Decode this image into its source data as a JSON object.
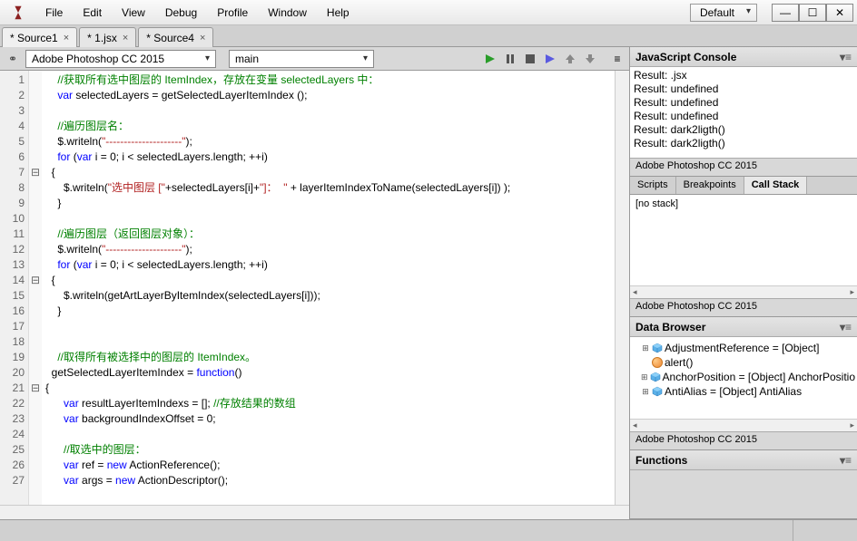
{
  "menu": [
    "File",
    "Edit",
    "View",
    "Debug",
    "Profile",
    "Window",
    "Help"
  ],
  "titleDropdown": "Default",
  "tabs": [
    {
      "label": "* Source1",
      "active": true
    },
    {
      "label": "* 1.jsx",
      "active": false
    },
    {
      "label": "* Source4",
      "active": false
    }
  ],
  "targetApp": "Adobe Photoshop CC 2015",
  "targetFunc": "main",
  "code": {
    "lines": [
      {
        "n": 1,
        "fold": "",
        "segs": [
          {
            "t": "    ",
            "c": ""
          },
          {
            "t": "//获取所有选中图层的 ItemIndex，存放在变量 selectedLayers 中：",
            "c": "c-com"
          }
        ]
      },
      {
        "n": 2,
        "fold": "",
        "segs": [
          {
            "t": "    ",
            "c": ""
          },
          {
            "t": "var",
            "c": "c-kw"
          },
          {
            "t": " selectedLayers = getSelectedLayerItemIndex ();",
            "c": ""
          }
        ]
      },
      {
        "n": 3,
        "fold": "",
        "segs": [
          {
            "t": "",
            "c": ""
          }
        ]
      },
      {
        "n": 4,
        "fold": "",
        "segs": [
          {
            "t": "    ",
            "c": ""
          },
          {
            "t": "//遍历图层名：",
            "c": "c-com"
          }
        ]
      },
      {
        "n": 5,
        "fold": "",
        "segs": [
          {
            "t": "    $.writeln(",
            "c": ""
          },
          {
            "t": "\"---------------------\"",
            "c": "c-str"
          },
          {
            "t": ");",
            "c": ""
          }
        ]
      },
      {
        "n": 6,
        "fold": "",
        "segs": [
          {
            "t": "    ",
            "c": ""
          },
          {
            "t": "for",
            "c": "c-kw"
          },
          {
            "t": " (",
            "c": ""
          },
          {
            "t": "var",
            "c": "c-kw"
          },
          {
            "t": " i = ",
            "c": ""
          },
          {
            "t": "0",
            "c": "c-num"
          },
          {
            "t": "; i < selectedLayers.length; ++i)",
            "c": ""
          }
        ]
      },
      {
        "n": 7,
        "fold": "⊟",
        "segs": [
          {
            "t": "  {",
            "c": ""
          }
        ]
      },
      {
        "n": 8,
        "fold": "",
        "segs": [
          {
            "t": "      $.writeln(",
            "c": ""
          },
          {
            "t": "\"选中图层 [\"",
            "c": "c-str"
          },
          {
            "t": "+selectedLayers[i]+",
            "c": ""
          },
          {
            "t": "\"]：  \"",
            "c": "c-str"
          },
          {
            "t": " + layerItemIndexToName(selectedLayers[i]) );",
            "c": ""
          }
        ]
      },
      {
        "n": 9,
        "fold": "",
        "segs": [
          {
            "t": "    }",
            "c": ""
          }
        ]
      },
      {
        "n": 10,
        "fold": "",
        "segs": [
          {
            "t": "",
            "c": ""
          }
        ]
      },
      {
        "n": 11,
        "fold": "",
        "segs": [
          {
            "t": "    ",
            "c": ""
          },
          {
            "t": "//遍历图层（返回图层对象）：",
            "c": "c-com"
          }
        ]
      },
      {
        "n": 12,
        "fold": "",
        "segs": [
          {
            "t": "    $.writeln(",
            "c": ""
          },
          {
            "t": "\"---------------------\"",
            "c": "c-str"
          },
          {
            "t": ");",
            "c": ""
          }
        ]
      },
      {
        "n": 13,
        "fold": "",
        "segs": [
          {
            "t": "    ",
            "c": ""
          },
          {
            "t": "for",
            "c": "c-kw"
          },
          {
            "t": " (",
            "c": ""
          },
          {
            "t": "var",
            "c": "c-kw"
          },
          {
            "t": " i = ",
            "c": ""
          },
          {
            "t": "0",
            "c": "c-num"
          },
          {
            "t": "; i < selectedLayers.length; ++i)",
            "c": ""
          }
        ]
      },
      {
        "n": 14,
        "fold": "⊟",
        "segs": [
          {
            "t": "  {",
            "c": ""
          }
        ]
      },
      {
        "n": 15,
        "fold": "",
        "segs": [
          {
            "t": "      $.writeln(getArtLayerByItemIndex(selectedLayers[i]));",
            "c": ""
          }
        ]
      },
      {
        "n": 16,
        "fold": "",
        "segs": [
          {
            "t": "    }",
            "c": ""
          }
        ]
      },
      {
        "n": 17,
        "fold": "",
        "segs": [
          {
            "t": "",
            "c": ""
          }
        ]
      },
      {
        "n": 18,
        "fold": "",
        "segs": [
          {
            "t": "",
            "c": ""
          }
        ]
      },
      {
        "n": 19,
        "fold": "",
        "segs": [
          {
            "t": "    ",
            "c": ""
          },
          {
            "t": "//取得所有被选择中的图层的 ItemIndex。",
            "c": "c-com"
          }
        ]
      },
      {
        "n": 20,
        "fold": "",
        "segs": [
          {
            "t": "  getSelectedLayerItemIndex = ",
            "c": ""
          },
          {
            "t": "function",
            "c": "c-kw"
          },
          {
            "t": "()",
            "c": ""
          }
        ]
      },
      {
        "n": 21,
        "fold": "⊟",
        "segs": [
          {
            "t": "{",
            "c": ""
          }
        ]
      },
      {
        "n": 22,
        "fold": "",
        "segs": [
          {
            "t": "      ",
            "c": ""
          },
          {
            "t": "var",
            "c": "c-kw"
          },
          {
            "t": " resultLayerItemIndexs = []; ",
            "c": ""
          },
          {
            "t": "//存放结果的数组",
            "c": "c-com"
          }
        ]
      },
      {
        "n": 23,
        "fold": "",
        "segs": [
          {
            "t": "      ",
            "c": ""
          },
          {
            "t": "var",
            "c": "c-kw"
          },
          {
            "t": " backgroundIndexOffset = ",
            "c": ""
          },
          {
            "t": "0",
            "c": "c-num"
          },
          {
            "t": ";",
            "c": ""
          }
        ]
      },
      {
        "n": 24,
        "fold": "",
        "segs": [
          {
            "t": "",
            "c": ""
          }
        ]
      },
      {
        "n": 25,
        "fold": "",
        "segs": [
          {
            "t": "      ",
            "c": ""
          },
          {
            "t": "//取选中的图层：",
            "c": "c-com"
          }
        ]
      },
      {
        "n": 26,
        "fold": "",
        "segs": [
          {
            "t": "      ",
            "c": ""
          },
          {
            "t": "var",
            "c": "c-kw"
          },
          {
            "t": " ref = ",
            "c": ""
          },
          {
            "t": "new",
            "c": "c-kw"
          },
          {
            "t": " ActionReference();",
            "c": ""
          }
        ]
      },
      {
        "n": 27,
        "fold": "",
        "segs": [
          {
            "t": "      ",
            "c": ""
          },
          {
            "t": "var",
            "c": "c-kw"
          },
          {
            "t": " args = ",
            "c": ""
          },
          {
            "t": "new",
            "c": "c-kw"
          },
          {
            "t": " ActionDescriptor();",
            "c": ""
          }
        ]
      }
    ]
  },
  "console": {
    "title": "JavaScript Console",
    "lines": [
      "Result: .jsx",
      "Result: undefined",
      "Result: undefined",
      "Result: undefined",
      "Result: dark2ligth()",
      "Result: dark2ligth()"
    ],
    "footer": "Adobe Photoshop CC 2015"
  },
  "callstack": {
    "tabs": [
      "Scripts",
      "Breakpoints",
      "Call Stack"
    ],
    "activeTab": 2,
    "content": "[no stack]",
    "footer": "Adobe Photoshop CC 2015"
  },
  "browser": {
    "title": "Data Browser",
    "items": [
      {
        "exp": "⊞",
        "icon": "cube",
        "label": "AdjustmentReference = [Object]"
      },
      {
        "exp": "",
        "icon": "ball",
        "label": "alert()"
      },
      {
        "exp": "⊞",
        "icon": "cube",
        "label": "AnchorPosition = [Object] AnchorPosition"
      },
      {
        "exp": "⊞",
        "icon": "cube",
        "label": "AntiAlias = [Object] AntiAlias"
      }
    ],
    "footer": "Adobe Photoshop CC 2015"
  },
  "functions": {
    "title": "Functions"
  }
}
